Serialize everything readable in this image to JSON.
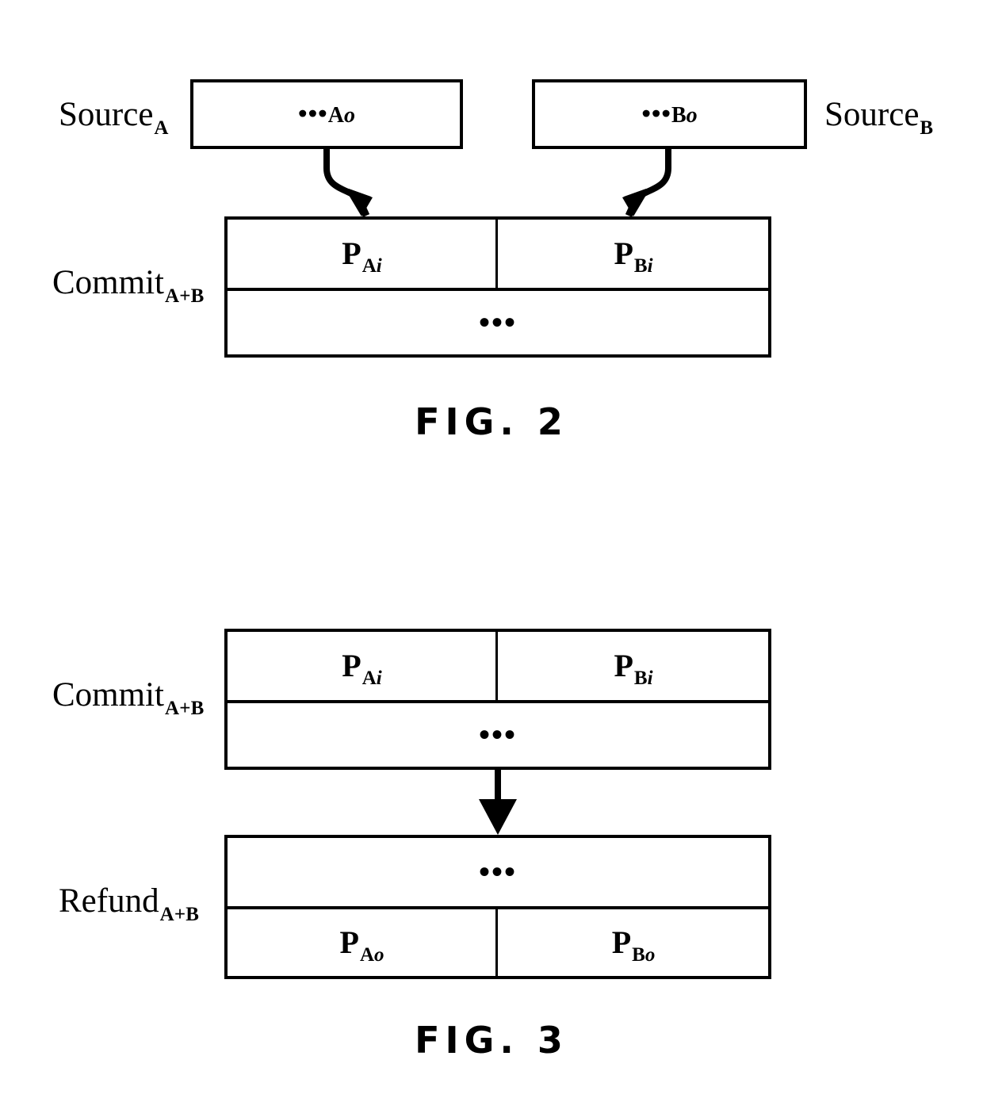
{
  "document": {
    "type": "patent-figure-sheet",
    "background_color": "#ffffff",
    "ink_color": "#000000"
  },
  "figures": [
    {
      "id": "fig2",
      "caption": "FIG. 2",
      "nodes": {
        "source_a": {
          "label_main": "Source",
          "label_sub": "A",
          "content": "A",
          "content_sub": "o",
          "content_dots": "•••"
        },
        "source_b": {
          "label_main": "Source",
          "label_sub": "B",
          "content": "B",
          "content_sub": "o",
          "content_dots": "•••"
        },
        "commit": {
          "label_main": "Commit",
          "label_sub": "A+B",
          "top_row": [
            {
              "main": "P",
              "sub_upright": "A",
              "sub_italic": "i"
            },
            {
              "main": "P",
              "sub_upright": "B",
              "sub_italic": "i"
            }
          ],
          "bottom_row_text": "•••"
        }
      },
      "arrows": [
        {
          "name": "source-a-to-commit",
          "style": "curved-left-to-right"
        },
        {
          "name": "source-b-to-commit",
          "style": "curved-right-to-left"
        }
      ]
    },
    {
      "id": "fig3",
      "caption": "FIG. 3",
      "nodes": {
        "commit": {
          "label_main": "Commit",
          "label_sub": "A+B",
          "top_row": [
            {
              "main": "P",
              "sub_upright": "A",
              "sub_italic": "i"
            },
            {
              "main": "P",
              "sub_upright": "B",
              "sub_italic": "i"
            }
          ],
          "bottom_row_text": "•••"
        },
        "refund": {
          "label_main": "Refund",
          "label_sub": "A+B",
          "top_row_text": "•••",
          "bottom_row": [
            {
              "main": "P",
              "sub_upright": "A",
              "sub_italic": "o"
            },
            {
              "main": "P",
              "sub_upright": "B",
              "sub_italic": "o"
            }
          ]
        }
      },
      "arrows": [
        {
          "name": "commit-to-refund",
          "style": "straight-down"
        }
      ]
    }
  ]
}
